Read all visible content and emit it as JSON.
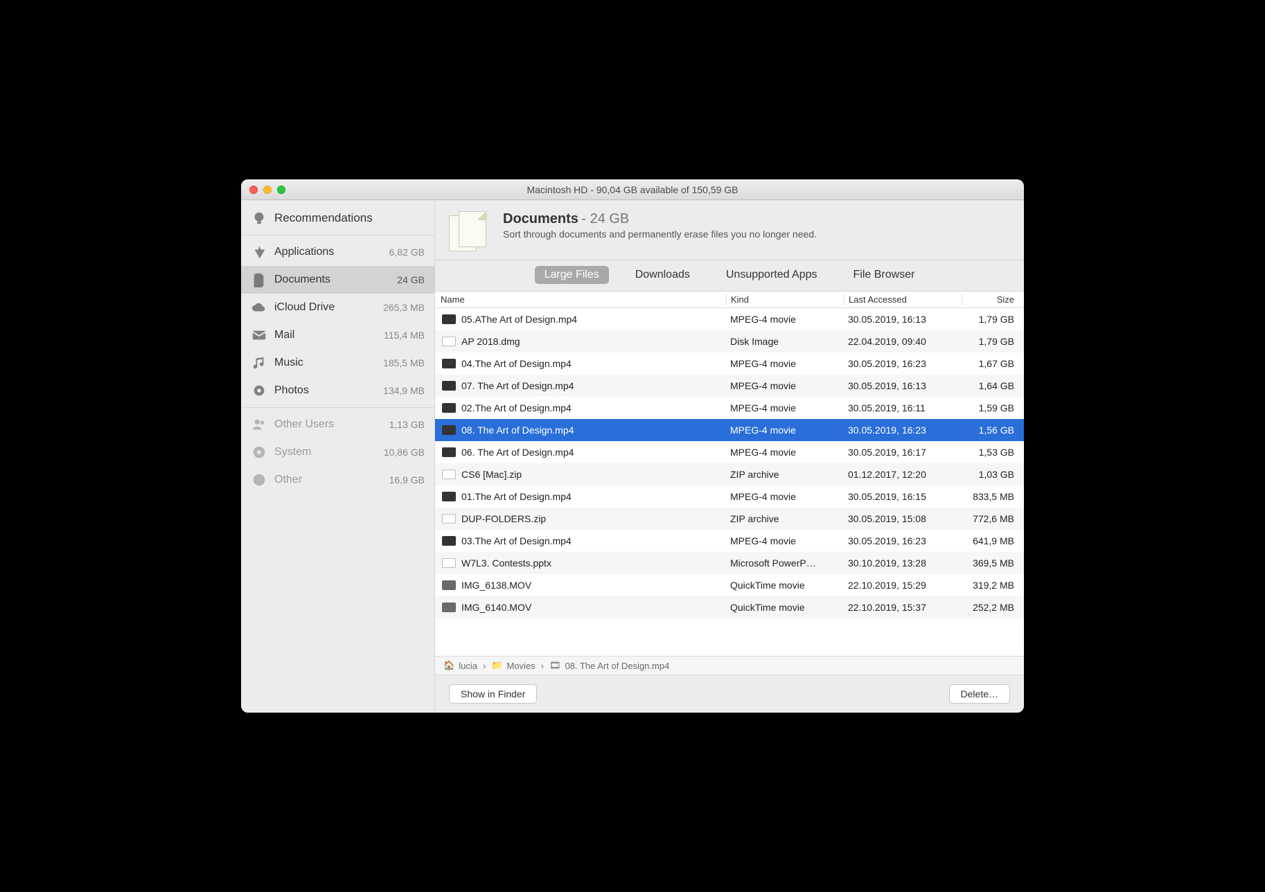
{
  "window_title": "Macintosh HD - 90,04 GB available of 150,59 GB",
  "sidebar": {
    "recommendations_label": "Recommendations",
    "items": [
      {
        "label": "Applications",
        "size": "6,82 GB"
      },
      {
        "label": "Documents",
        "size": "24 GB"
      },
      {
        "label": "iCloud Drive",
        "size": "265,3 MB"
      },
      {
        "label": "Mail",
        "size": "115,4 MB"
      },
      {
        "label": "Music",
        "size": "185,5 MB"
      },
      {
        "label": "Photos",
        "size": "134,9 MB"
      }
    ],
    "dim_items": [
      {
        "label": "Other Users",
        "size": "1,13 GB"
      },
      {
        "label": "System",
        "size": "10,86 GB"
      },
      {
        "label": "Other",
        "size": "16,9 GB"
      }
    ]
  },
  "header": {
    "title": "Documents",
    "title_size": " - 24 GB",
    "subtitle": "Sort through documents and permanently erase files you no longer need."
  },
  "tabs": {
    "t0": "Large Files",
    "t1": "Downloads",
    "t2": "Unsupported Apps",
    "t3": "File Browser"
  },
  "columns": {
    "name": "Name",
    "kind": "Kind",
    "last": "Last Accessed",
    "size": "Size"
  },
  "files": [
    {
      "name": "05.AThe Art of Design.mp4",
      "kind": "MPEG-4 movie",
      "last": "30.05.2019, 16:13",
      "size": "1,79 GB",
      "icon": "mp4"
    },
    {
      "name": "AP 2018.dmg",
      "kind": "Disk Image",
      "last": "22.04.2019, 09:40",
      "size": "1,79 GB",
      "icon": "dmg"
    },
    {
      "name": "04.The Art of Design.mp4",
      "kind": "MPEG-4 movie",
      "last": "30.05.2019, 16:23",
      "size": "1,67 GB",
      "icon": "mp4"
    },
    {
      "name": "07. The Art of Design.mp4",
      "kind": "MPEG-4 movie",
      "last": "30.05.2019, 16:13",
      "size": "1,64 GB",
      "icon": "mp4"
    },
    {
      "name": "02.The Art of Design.mp4",
      "kind": "MPEG-4 movie",
      "last": "30.05.2019, 16:11",
      "size": "1,59 GB",
      "icon": "mp4"
    },
    {
      "name": "08. The Art of Design.mp4",
      "kind": "MPEG-4 movie",
      "last": "30.05.2019, 16:23",
      "size": "1,56 GB",
      "icon": "mp4",
      "selected": true
    },
    {
      "name": "06. The Art of Design.mp4",
      "kind": "MPEG-4 movie",
      "last": "30.05.2019, 16:17",
      "size": "1,53 GB",
      "icon": "mp4"
    },
    {
      "name": "CS6 [Mac].zip",
      "kind": "ZIP archive",
      "last": "01.12.2017, 12:20",
      "size": "1,03 GB",
      "icon": "zip"
    },
    {
      "name": "01.The Art of Design.mp4",
      "kind": "MPEG-4 movie",
      "last": "30.05.2019, 16:15",
      "size": "833,5 MB",
      "icon": "mp4"
    },
    {
      "name": "DUP-FOLDERS.zip",
      "kind": "ZIP archive",
      "last": "30.05.2019, 15:08",
      "size": "772,6 MB",
      "icon": "zip"
    },
    {
      "name": "03.The Art of Design.mp4",
      "kind": "MPEG-4 movie",
      "last": "30.05.2019, 16:23",
      "size": "641,9 MB",
      "icon": "mp4"
    },
    {
      "name": "W7L3. Contests.pptx",
      "kind": "Microsoft PowerP…",
      "last": "30.10.2019, 13:28",
      "size": "369,5 MB",
      "icon": "ppt"
    },
    {
      "name": "IMG_6138.MOV",
      "kind": "QuickTime movie",
      "last": "22.10.2019, 15:29",
      "size": "319,2 MB",
      "icon": "mov"
    },
    {
      "name": "IMG_6140.MOV",
      "kind": "QuickTime movie",
      "last": "22.10.2019, 15:37",
      "size": "252,2 MB",
      "icon": "mov"
    }
  ],
  "path": {
    "p0": "lucia",
    "p1": "Movies",
    "p2": "08. The Art of Design.mp4"
  },
  "footer": {
    "show": "Show in Finder",
    "delete": "Delete…"
  }
}
